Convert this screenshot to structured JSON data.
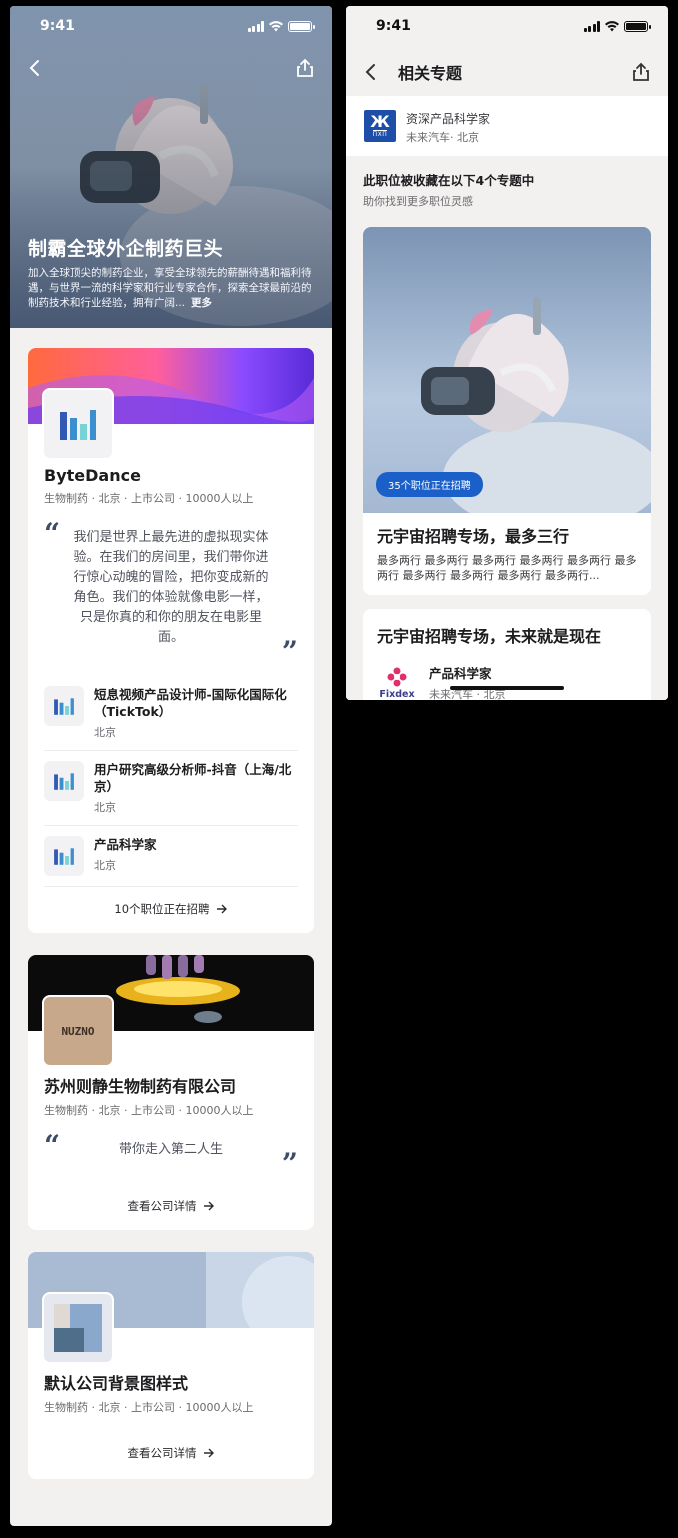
{
  "colors": {
    "brand_blue": "#1b60c8",
    "bg_gray": "#f2f1ef",
    "quote_blue": "#3c4b66"
  },
  "left_phone": {
    "status": {
      "time": "9:41"
    },
    "hero": {
      "title": "制霸全球外企制药巨头",
      "description": "加入全球顶尖的制药企业，享受全球领先的薪酬待遇和福利待遇，与世界一流的科学家和行业专家合作，探索全球最前沿的制药技术和行业经验，拥有广阔...",
      "more": "更多"
    },
    "companies": [
      {
        "name": "ByteDance",
        "meta": "生物制药 · 北京 · 上市公司 · 10000人以上",
        "quote": "我们是世界上最先进的虚拟现实体验。在我们的房间里，我们带你进行惊心动魄的冒险，把你变成新的角色。我们的体验就像电影一样，只是你真的和你的朋友在电影里面。",
        "jobs": [
          {
            "title": "短息视频产品设计师-国际化国际化（TickTok）",
            "location": "北京"
          },
          {
            "title": "用户研究高级分析师-抖音（上海/北京）",
            "location": "北京"
          },
          {
            "title": "产品科学家",
            "location": "北京"
          }
        ],
        "link": "10个职位正在招聘"
      },
      {
        "name": "苏州则静生物制药有限公司",
        "meta": "生物制药 · 北京 · 上市公司 · 10000人以上",
        "quote": "带你走入第二人生",
        "logo_text": "NUZNO",
        "link": "查看公司详情"
      },
      {
        "name": "默认公司背景图样式",
        "meta": "生物制药 · 北京 · 上市公司 · 10000人以上",
        "link": "查看公司详情"
      }
    ]
  },
  "right_phone": {
    "status": {
      "time": "9:41"
    },
    "nav_title": "相关专题",
    "job": {
      "title": "资深产品科学家",
      "company": "未来汽车· 北京",
      "logo_big": "Ж",
      "logo_small": "ΠXΠ"
    },
    "section_title": "此职位被收藏在以下4个专题中",
    "section_sub": "助你找到更多职位灵感",
    "topics": [
      {
        "badge": "35个职位正在招聘",
        "title": "元宇宙招聘专场，最多三行",
        "desc": "最多两行 最多两行 最多两行 最多两行 最多两行 最多两行 最多两行 最多两行 最多两行 最多两行..."
      },
      {
        "title": "元宇宙招聘专场，未来就是现在",
        "job_title": "产品科学家",
        "job_loc": "未来汽车 · 北京",
        "logo_text": "Fixdex"
      }
    ]
  }
}
